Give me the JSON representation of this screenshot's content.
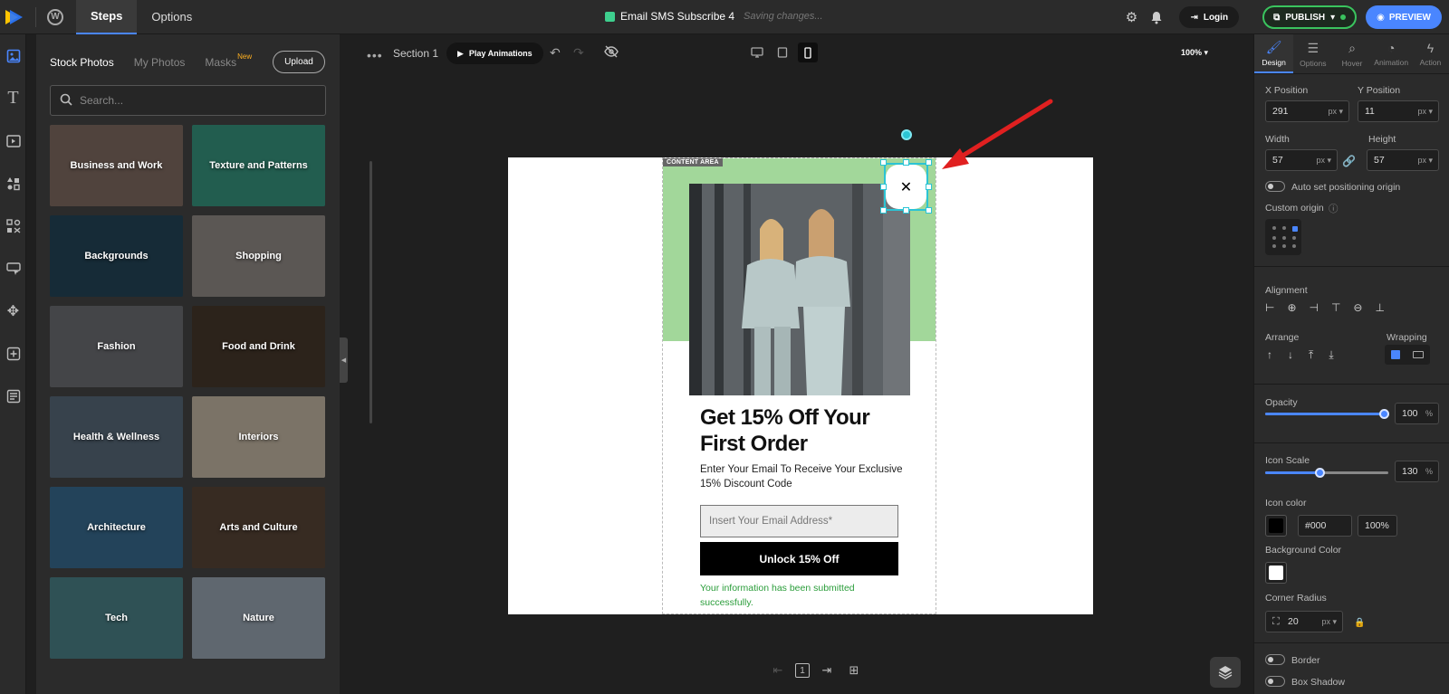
{
  "topbar": {
    "tabs": [
      "Steps",
      "Options"
    ],
    "active_tab": "Steps",
    "doc_title": "Email SMS Subscribe 4",
    "saving_text": "Saving changes...",
    "login_label": "Login",
    "publish_label": "PUBLISH",
    "preview_label": "PREVIEW"
  },
  "rail": {
    "items": [
      "image-icon",
      "text-icon",
      "video-icon",
      "shapes-icon",
      "elements-icon",
      "form-icon",
      "move-icon",
      "add-icon",
      "layout-icon"
    ],
    "active": "image-icon"
  },
  "left_panel": {
    "tabs": [
      "Stock Photos",
      "My Photos",
      "Masks"
    ],
    "new_badge": "New",
    "upload_label": "Upload",
    "search_placeholder": "Search...",
    "categories": [
      {
        "label": "Business and Work",
        "color": "#6b5a52"
      },
      {
        "label": "Texture and Patterns",
        "color": "#2e7d6a"
      },
      {
        "label": "Backgrounds",
        "color": "#1e3a4a"
      },
      {
        "label": "Shopping",
        "color": "#7a7570"
      },
      {
        "label": "Fashion",
        "color": "#5b5d60"
      },
      {
        "label": "Food and Drink",
        "color": "#3b2f25"
      },
      {
        "label": "Health & Wellness",
        "color": "#4a5866"
      },
      {
        "label": "Interiors",
        "color": "#a49a8a"
      },
      {
        "label": "Architecture",
        "color": "#2f5a78"
      },
      {
        "label": "Arts and Culture",
        "color": "#4a3a2e"
      },
      {
        "label": "Tech",
        "color": "#3f6c72"
      },
      {
        "label": "Nature",
        "color": "#7f8a94"
      }
    ]
  },
  "canvas_bar": {
    "section_name": "Section 1",
    "play_label": "Play Animations",
    "zoom": "100%"
  },
  "popup": {
    "content_area_label": "CONTENT AREA",
    "headline": "Get 15% Off Your First Order",
    "subtext": "Enter Your Email To Receive Your Exclusive 15% Discount Code",
    "email_placeholder": "Insert Your Email Address*",
    "button_label": "Unlock 15% Off",
    "success_text": "Your information has been submitted successfully.",
    "close_glyph": "✕"
  },
  "bottom_tools": {
    "page_number": "1"
  },
  "right_panel": {
    "tabs": [
      "Design",
      "Options",
      "Hover",
      "Animation",
      "Action"
    ],
    "active_tab": "Design",
    "x_position_label": "X Position",
    "y_position_label": "Y Position",
    "x_value": "291",
    "y_value": "11",
    "width_label": "Width",
    "height_label": "Height",
    "width_value": "57",
    "height_value": "57",
    "unit": "px",
    "auto_origin_label": "Auto set positioning origin",
    "custom_origin_label": "Custom origin",
    "alignment_label": "Alignment",
    "arrange_label": "Arrange",
    "wrapping_label": "Wrapping",
    "opacity_label": "Opacity",
    "opacity_value": "100",
    "percent": "%",
    "icon_scale_label": "Icon Scale",
    "icon_scale_value": "130",
    "icon_color_label": "Icon color",
    "icon_color_value": "#000",
    "icon_color_opacity": "100%",
    "bg_color_label": "Background Color",
    "corner_radius_label": "Corner Radius",
    "corner_radius_value": "20",
    "border_label": "Border",
    "box_shadow_label": "Box Shadow"
  },
  "colors": {
    "accent": "#4a86ff",
    "publish": "#3ac45e",
    "selection": "#2bc4d4",
    "green_bg": "#a2d79a",
    "arrow": "#e02020"
  }
}
